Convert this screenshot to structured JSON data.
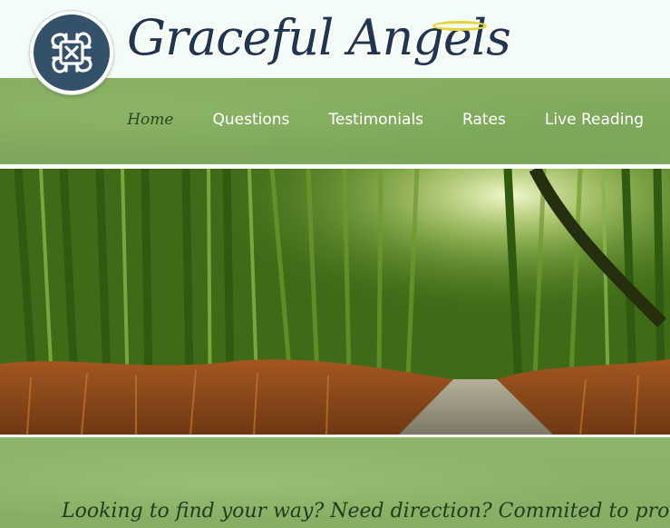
{
  "brand": {
    "name": "Graceful Angels",
    "logo_icon": "celtic-knot-icon",
    "halo_icon": "halo-icon"
  },
  "nav": {
    "items": [
      {
        "label": "Home",
        "active": true
      },
      {
        "label": "Questions",
        "active": false
      },
      {
        "label": "Testimonials",
        "active": false
      },
      {
        "label": "Rates",
        "active": false
      },
      {
        "label": "Live Reading",
        "active": false
      }
    ]
  },
  "hero": {
    "image": "bamboo-forest-path"
  },
  "tagline": "Looking to find your way? Need direction? Commited to provid",
  "colors": {
    "navy": "#34506b",
    "green_band": "#86ad62",
    "active_nav": "#2d4422",
    "halo": "#e8d23a"
  }
}
